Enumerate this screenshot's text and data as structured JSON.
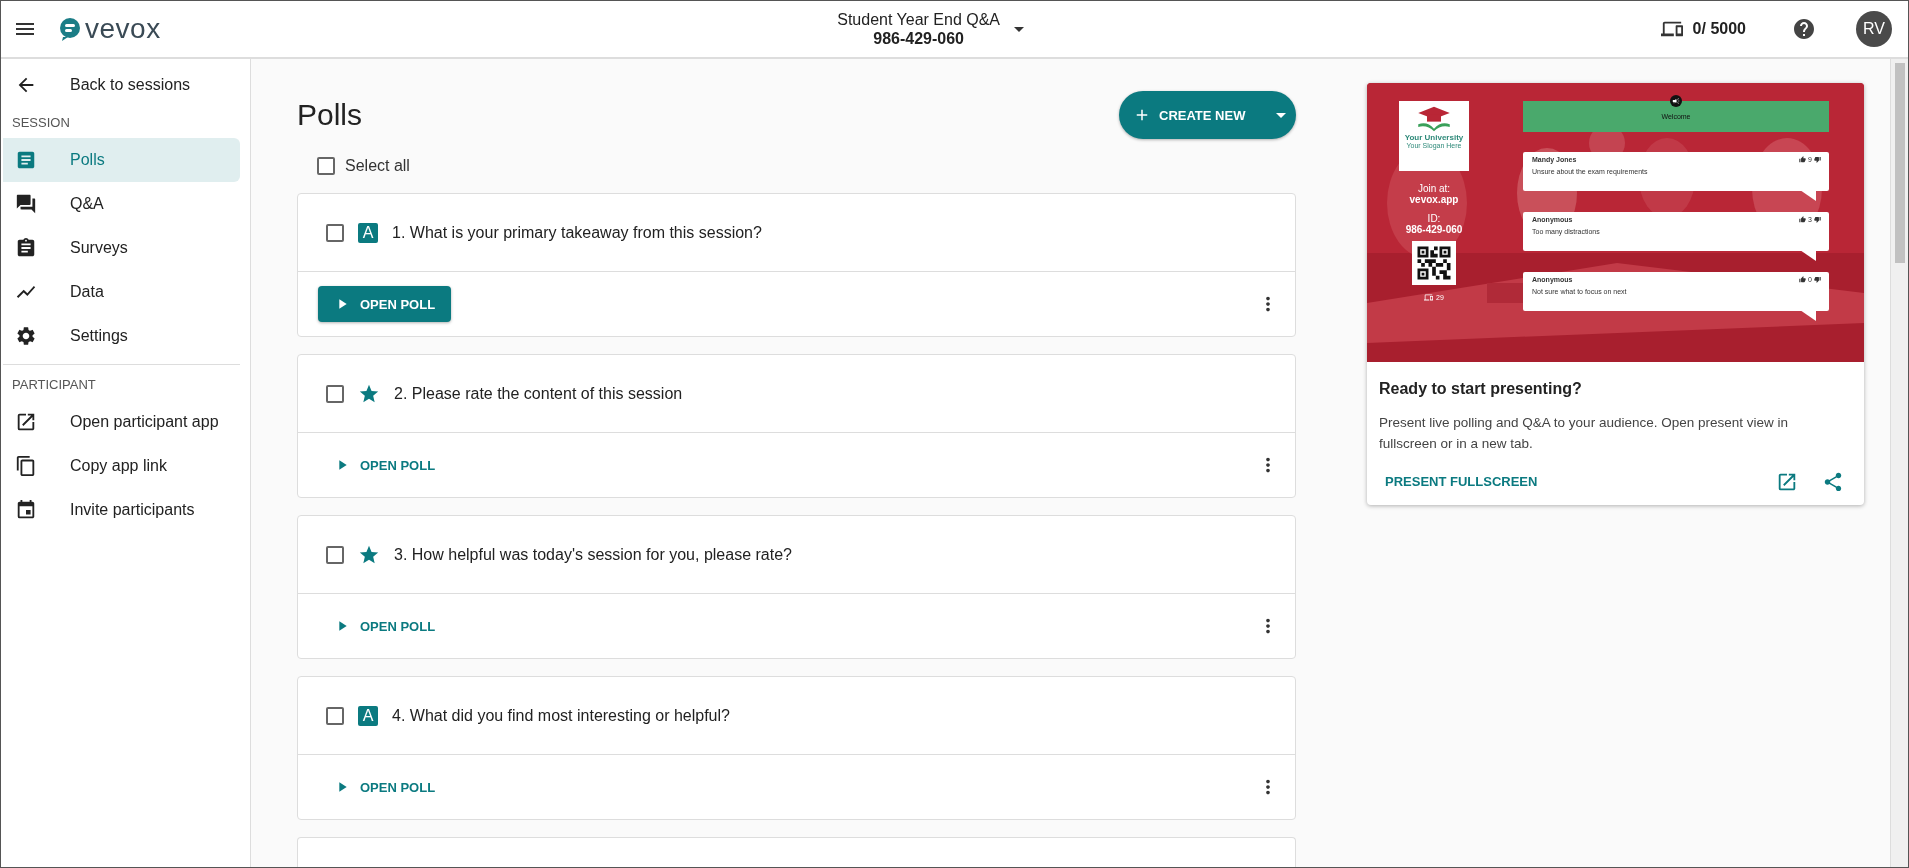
{
  "header": {
    "brand": "vevox",
    "session_title": "Student Year End Q&A",
    "session_id": "986-429-060",
    "devices": "0/ 5000",
    "avatar": "RV"
  },
  "sidebar": {
    "back": "Back to sessions",
    "sections": [
      {
        "label": "SESSION",
        "items": [
          {
            "label": "Polls",
            "selected": true
          },
          {
            "label": "Q&A",
            "selected": false
          },
          {
            "label": "Surveys",
            "selected": false
          },
          {
            "label": "Data",
            "selected": false
          },
          {
            "label": "Settings",
            "selected": false
          }
        ]
      },
      {
        "label": "PARTICIPANT",
        "items": [
          {
            "label": "Open participant app",
            "selected": false
          },
          {
            "label": "Copy app link",
            "selected": false
          },
          {
            "label": "Invite participants",
            "selected": false
          }
        ]
      }
    ]
  },
  "main": {
    "title": "Polls",
    "create_button": "CREATE NEW",
    "select_all": {
      "label": "Select all",
      "checked": false
    },
    "polls": [
      {
        "kind": "text",
        "badge": "A",
        "title": "1. What is your primary takeaway from this session?",
        "checked": false,
        "action": "OPEN POLL",
        "active": true
      },
      {
        "kind": "rating",
        "title": "2. Please rate the content of this session",
        "checked": false,
        "action": "OPEN POLL",
        "active": false
      },
      {
        "kind": "rating",
        "title": "3. How helpful was today's session for you, please rate?",
        "checked": false,
        "action": "OPEN POLL",
        "active": false
      },
      {
        "kind": "text",
        "badge": "A",
        "title": "4. What did you find most interesting or helpful?",
        "checked": false,
        "action": "OPEN POLL",
        "active": false
      }
    ]
  },
  "preview": {
    "slide": {
      "logo_name": "Your University",
      "logo_slogan": "Your Slogan Here",
      "join_label": "Join at:",
      "join_url": "vevox.app",
      "id_label": "ID:",
      "id": "986-429-060",
      "participants": "29",
      "banner": "Welcome",
      "comments": [
        {
          "author": "Mandy Jones",
          "text": "Unsure about the exam requirements",
          "votes": "9"
        },
        {
          "author": "Anonymous",
          "text": "Too many distractions",
          "votes": "3"
        },
        {
          "author": "Anonymous",
          "text": "Not sure what to focus on next",
          "votes": "0"
        }
      ]
    },
    "heading": "Ready to start presenting?",
    "description": "Present live polling and Q&A to your audience. Open present view in fullscreen or in a new tab.",
    "action": "PRESENT FULLSCREEN"
  }
}
